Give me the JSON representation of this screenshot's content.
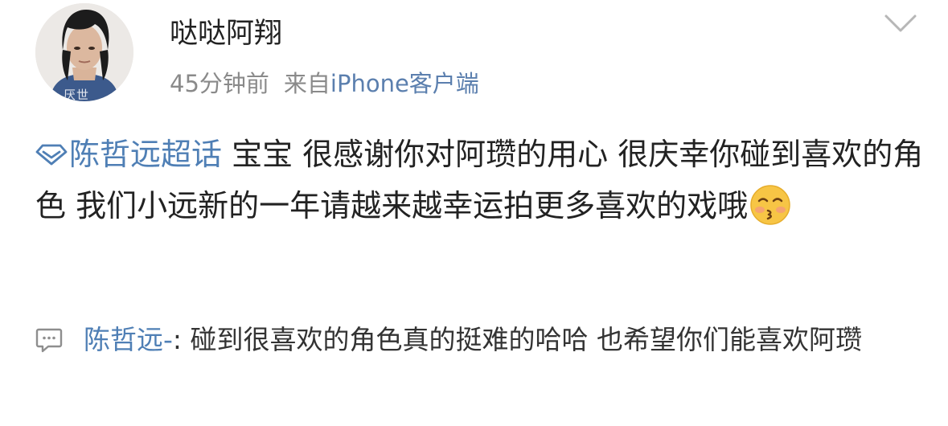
{
  "post": {
    "author": {
      "name": "哒哒阿翔",
      "avatar_watermark": "厌世"
    },
    "meta": {
      "time": "45分钟前",
      "source_label": "来自",
      "source_link": "iPhone客户端"
    },
    "menu_icon": "chevron-down-icon",
    "topic": {
      "icon": "diamond-topic-icon",
      "label": "陈哲远超话"
    },
    "text": " 宝宝 很感谢你对阿瓒的用心 很庆幸你碰到喜欢的角色 我们小远新的一年请越来越幸运拍更多喜欢的戏哦",
    "emoji": "kissing-face-icon"
  },
  "comment": {
    "icon": "comment-icon",
    "author": "陈哲远-",
    "text": ": 碰到很喜欢的角色真的挺难的哈哈 也希望你们能喜欢阿瓒"
  },
  "colors": {
    "link": "#4f7fb5",
    "meta_gray": "#8a8a8a",
    "emoji_yellow": "#f7c545"
  }
}
